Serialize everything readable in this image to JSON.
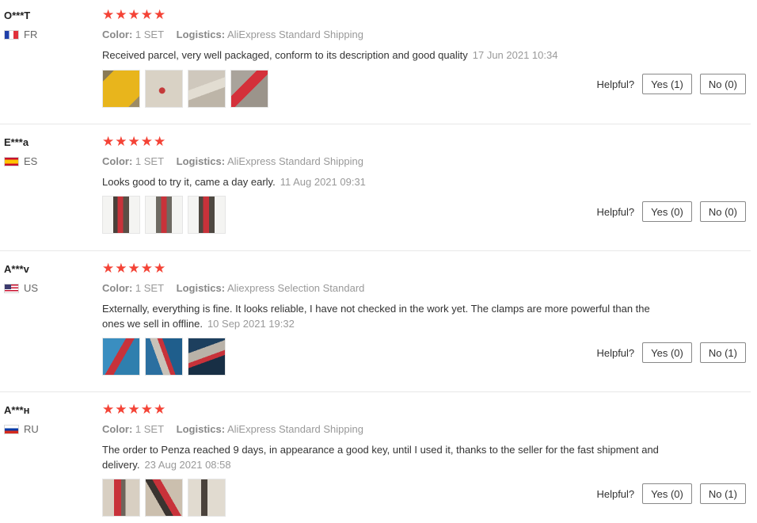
{
  "helpful_label": "Helpful?",
  "reviews": [
    {
      "user": "O***T",
      "flag": "fr",
      "country": "FR",
      "stars": "★★★★★",
      "rating": 5,
      "color_label": "Color:",
      "color_value": "1 SET",
      "logistics_label": "Logistics:",
      "logistics_value": "AliExpress Standard Shipping",
      "text": "Received parcel, very well packaged, conform to its description and good quality",
      "date": "17 Jun 2021 10:34",
      "yes": "Yes (1)",
      "no": "No (0)"
    },
    {
      "user": "E***a",
      "flag": "es",
      "country": "ES",
      "stars": "★★★★★",
      "rating": 5,
      "color_label": "Color:",
      "color_value": "1 SET",
      "logistics_label": "Logistics:",
      "logistics_value": "AliExpress Standard Shipping",
      "text": "Looks good to try it, came a day early.",
      "date": "11 Aug 2021 09:31",
      "yes": "Yes (0)",
      "no": "No (0)"
    },
    {
      "user": "A***v",
      "flag": "us",
      "country": "US",
      "stars": "★★★★★",
      "rating": 5,
      "color_label": "Color:",
      "color_value": "1 SET",
      "logistics_label": "Logistics:",
      "logistics_value": "Aliexpress Selection Standard",
      "text": "Externally, everything is fine. It looks reliable, I have not checked in the work yet. The clamps are more powerful than the ones we sell in offline.",
      "date": "10 Sep 2021 19:32",
      "yes": "Yes (0)",
      "no": "No (1)"
    },
    {
      "user": "A***н",
      "flag": "ru",
      "country": "RU",
      "stars": "★★★★★",
      "rating": 5,
      "color_label": "Color:",
      "color_value": "1 SET",
      "logistics_label": "Logistics:",
      "logistics_value": "AliExpress Standard Shipping",
      "text": "The order to Penza reached 9 days, in appearance a good key, until I used it, thanks to the seller for the fast shipment and delivery.",
      "date": "23 Aug 2021 08:58",
      "yes": "Yes (0)",
      "no": "No (1)"
    }
  ]
}
